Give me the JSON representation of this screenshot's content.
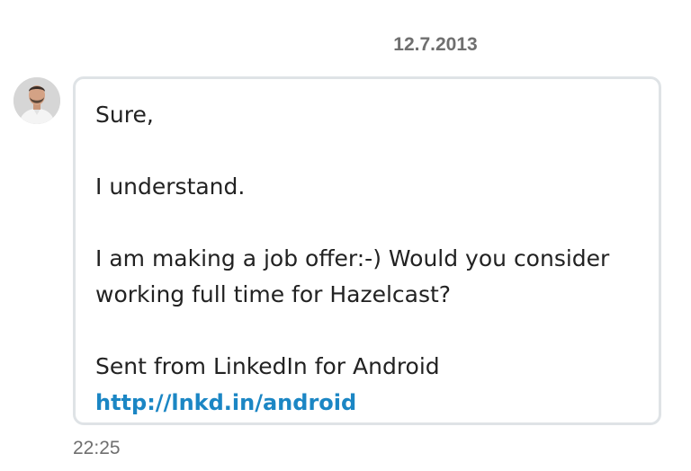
{
  "conversation": {
    "date_separator": "12.7.2013"
  },
  "message": {
    "sender_avatar": "avatar-photo",
    "lines": [
      "Sure,",
      "I understand.",
      "I am making a job offer:-) Would you consider",
      "working full time for Hazelcast?",
      "Sent from LinkedIn for Android"
    ],
    "link_text": "http://lnkd.in/android",
    "timestamp": "22:25"
  },
  "colors": {
    "link": "#1b86c4",
    "meta_text": "#6f6f6f",
    "bubble_border": "#dfe3e6",
    "body_text": "#222222"
  }
}
